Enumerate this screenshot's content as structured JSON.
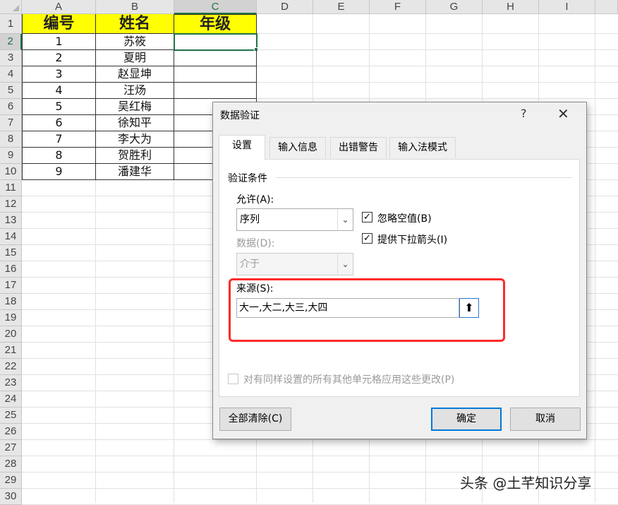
{
  "sheet": {
    "columns": [
      "A",
      "B",
      "C",
      "D",
      "E",
      "F",
      "G",
      "H",
      "I"
    ],
    "rows": [
      "1",
      "2",
      "3",
      "4",
      "5",
      "6",
      "7",
      "8",
      "9",
      "10",
      "11",
      "12",
      "13",
      "14",
      "15",
      "16",
      "17",
      "18",
      "19",
      "20",
      "21",
      "22",
      "23",
      "24",
      "25",
      "26",
      "27",
      "28",
      "29",
      "30"
    ],
    "header": {
      "a": "编号",
      "b": "姓名",
      "c": "年级"
    },
    "data": [
      {
        "id": "1",
        "name": "苏筱"
      },
      {
        "id": "2",
        "name": "夏明"
      },
      {
        "id": "3",
        "name": "赵显坤"
      },
      {
        "id": "4",
        "name": "汪炀"
      },
      {
        "id": "5",
        "name": "吴红梅"
      },
      {
        "id": "6",
        "name": "徐知平"
      },
      {
        "id": "7",
        "name": "李大为"
      },
      {
        "id": "8",
        "name": "贺胜利"
      },
      {
        "id": "9",
        "name": "潘建华"
      }
    ],
    "header_fill": "#ffff00",
    "selection_color": "#217346"
  },
  "dialog": {
    "title": "数据验证",
    "help": "?",
    "close": "✕",
    "tabs": [
      "设置",
      "输入信息",
      "出错警告",
      "输入法模式"
    ],
    "section_title": "验证条件",
    "allow_label": "允许(A):",
    "allow_value": "序列",
    "ignore_blank_label": "忽略空值(B)",
    "dropdown_arrow_label": "提供下拉箭头(I)",
    "data_label": "数据(D):",
    "data_value": "介于",
    "source_label": "来源(S):",
    "source_value": "大一,大二,大三,大四",
    "apply_all_label": "对有同样设置的所有其他单元格应用这些更改(P)",
    "clear_all": "全部清除(C)",
    "ok": "确定",
    "cancel": "取消",
    "check_mark": "✓",
    "combo_arrow": "⌄",
    "collapse_icon": "⬆",
    "highlight_color": "#ff2a2a"
  },
  "watermark": "头条 @土芊知识分享"
}
